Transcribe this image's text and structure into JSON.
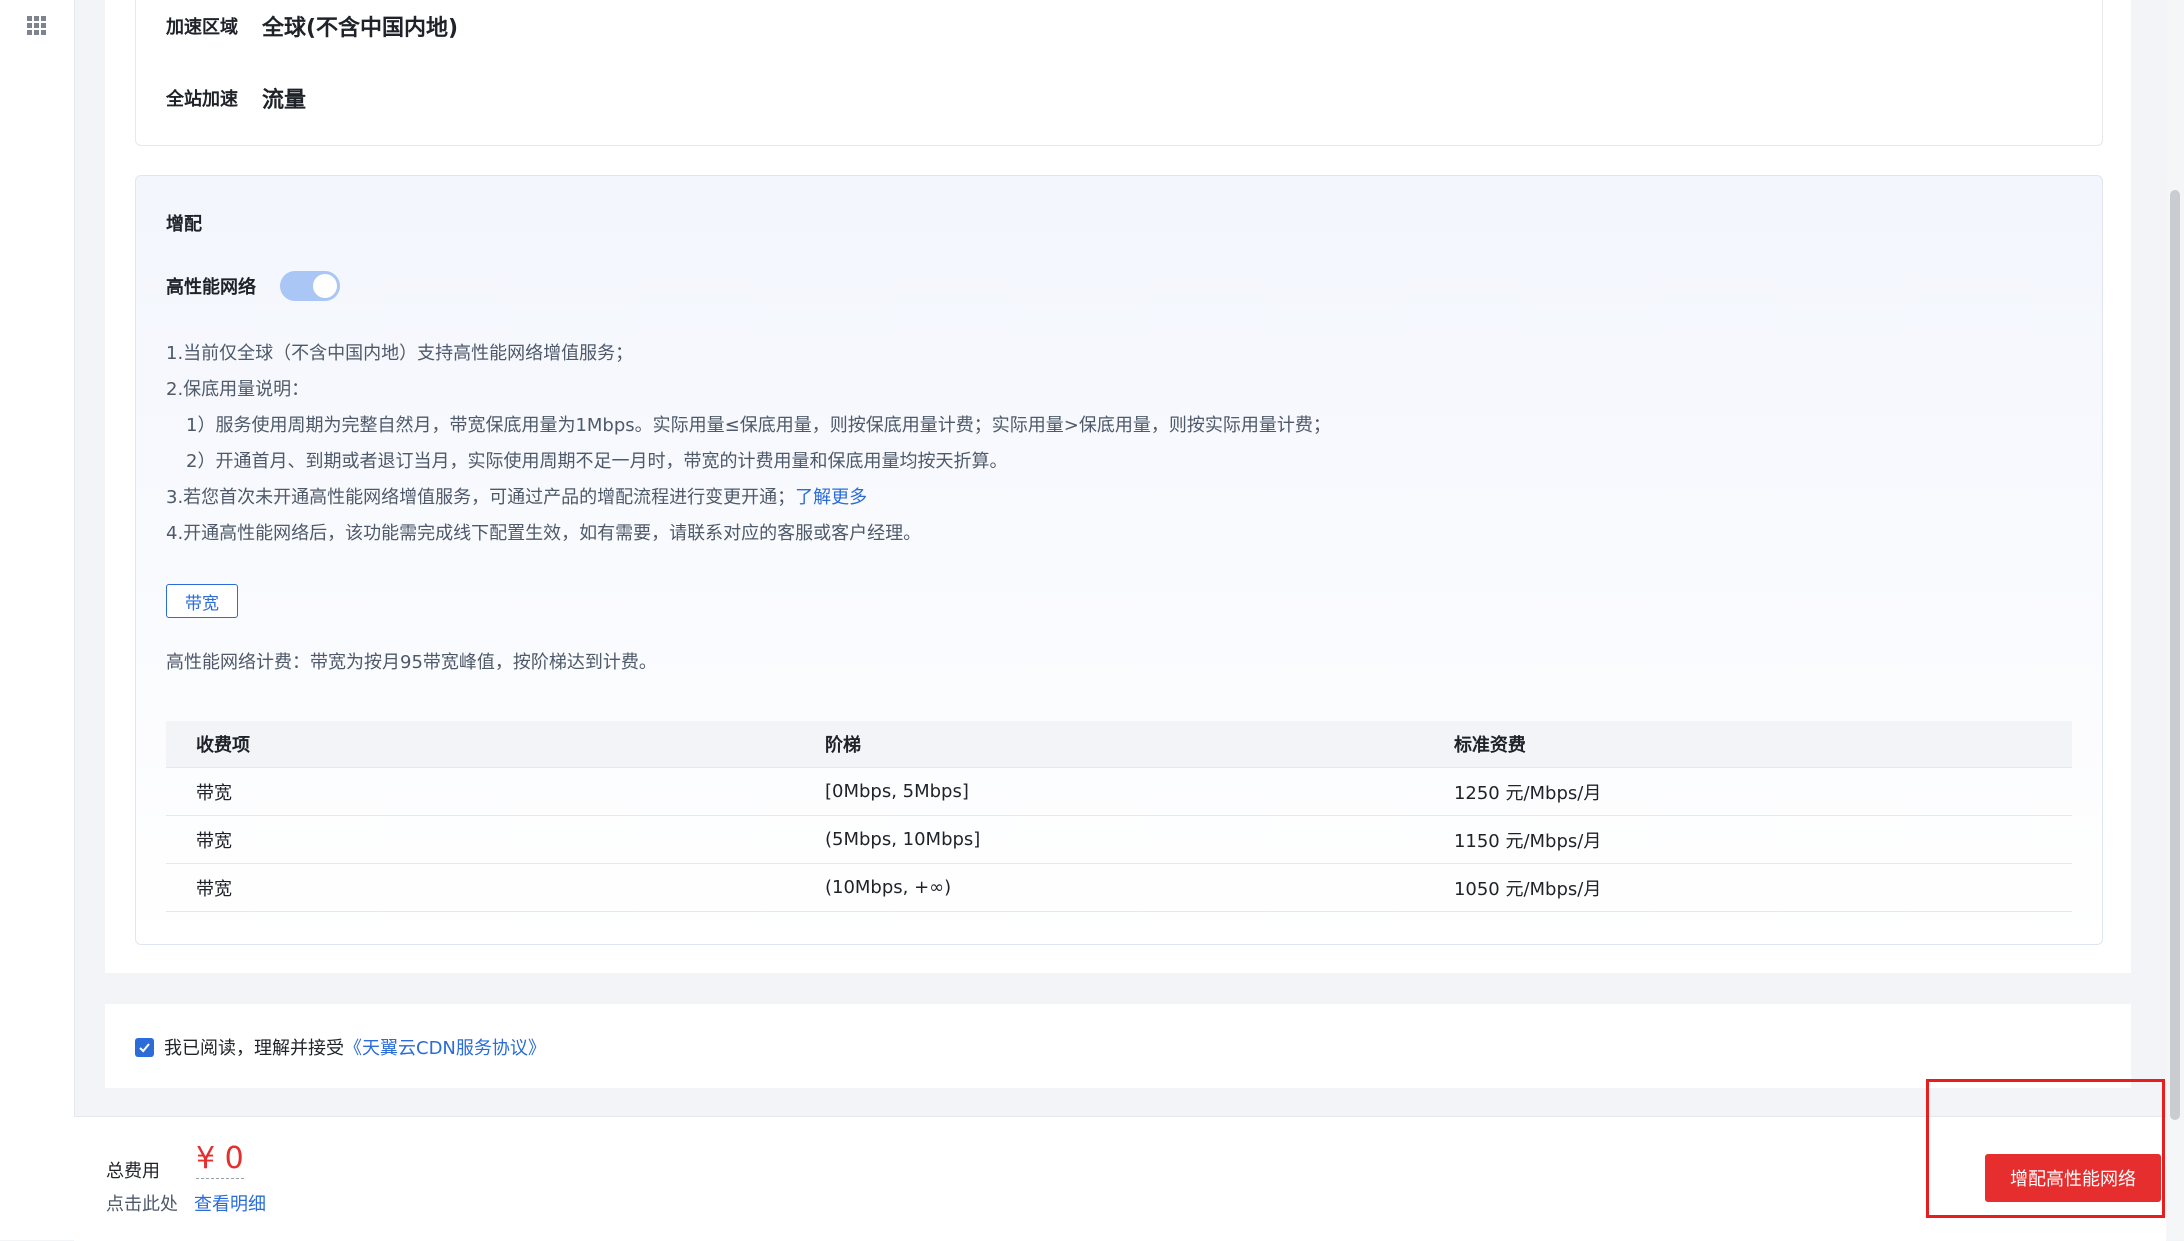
{
  "region": {
    "label": "加速区域",
    "value": "全球(不含中国内地)"
  },
  "site_acceleration": {
    "label": "全站加速",
    "value": "流量"
  },
  "addon": {
    "title": "增配",
    "toggle_label": "高性能网络",
    "toggle_on": true,
    "notes": {
      "n1": "1.当前仅全球（不含中国内地）支持高性能网络增值服务；",
      "n2": "2.保底用量说明：",
      "n2a": "1）服务使用周期为完整自然月，带宽保底用量为1Mbps。实际用量≤保底用量，则按保底用量计费；实际用量>保底用量，则按实际用量计费；",
      "n2b": "2）开通首月、到期或者退订当月，实际使用周期不足一月时，带宽的计费用量和保底用量均按天折算。",
      "n3": "3.若您首次未开通高性能网络增值服务，可通过产品的增配流程进行变更开通；",
      "n3_link": "了解更多",
      "n4": "4.开通高性能网络后，该功能需完成线下配置生效，如有需要，请联系对应的客服或客户经理。"
    },
    "tag": "带宽",
    "pricing_note": "高性能网络计费：带宽为按月95带宽峰值，按阶梯达到计费。",
    "table": {
      "headers": [
        "收费项",
        "阶梯",
        "标准资费"
      ],
      "rows": [
        [
          "带宽",
          "[0Mbps, 5Mbps]",
          "1250 元/Mbps/月"
        ],
        [
          "带宽",
          "(5Mbps, 10Mbps]",
          "1150 元/Mbps/月"
        ],
        [
          "带宽",
          "(10Mbps, +∞)",
          "1050 元/Mbps/月"
        ]
      ]
    }
  },
  "agreement": {
    "checked": true,
    "text": "我已阅读，理解并接受",
    "link": "《天翼云CDN服务协议》"
  },
  "footer": {
    "total_label": "总费用",
    "price": "¥ 0",
    "click_here": "点击此处",
    "detail_link": "查看明细",
    "submit_label": "增配高性能网络"
  },
  "colors": {
    "accent": "#2b6cd9",
    "danger": "#e62e2e",
    "toggle": "#a9c6f5"
  },
  "icons": {
    "apps": "grid-apps-icon",
    "check": "checkmark-icon"
  }
}
